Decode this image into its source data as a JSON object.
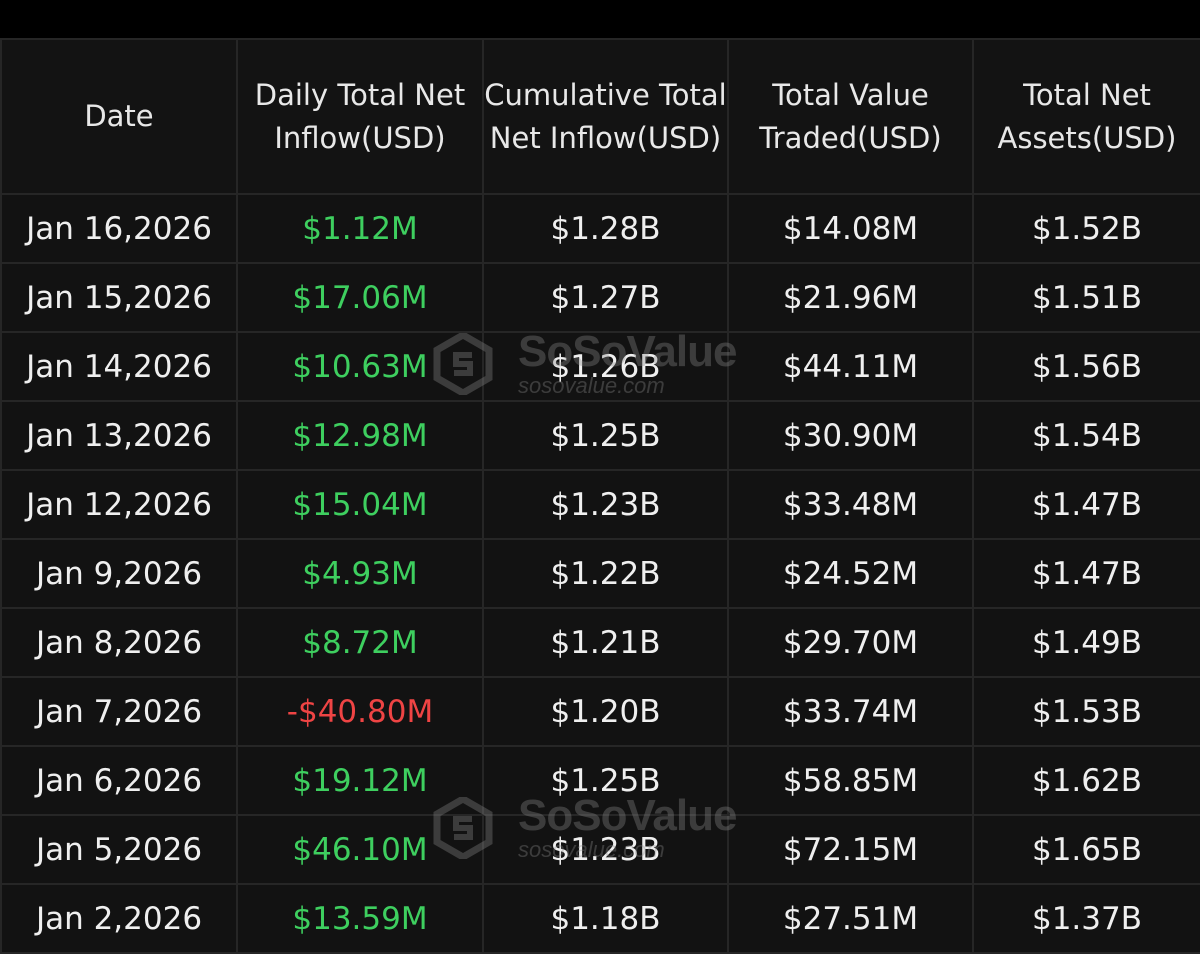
{
  "table": {
    "headers": {
      "date": "Date",
      "daily_net_inflow": "Daily Total Net Inflow(USD)",
      "cumulative_net_inflow": "Cumulative Total Net Inflow(USD)",
      "total_value_traded": "Total Value Traded(USD)",
      "total_net_assets": "Total Net Assets(USD)"
    },
    "rows": [
      {
        "date": "Jan 16,2026",
        "daily": "$1.12M",
        "daily_sign": "positive",
        "cumulative": "$1.28B",
        "traded": "$14.08M",
        "assets": "$1.52B"
      },
      {
        "date": "Jan 15,2026",
        "daily": "$17.06M",
        "daily_sign": "positive",
        "cumulative": "$1.27B",
        "traded": "$21.96M",
        "assets": "$1.51B"
      },
      {
        "date": "Jan 14,2026",
        "daily": "$10.63M",
        "daily_sign": "positive",
        "cumulative": "$1.26B",
        "traded": "$44.11M",
        "assets": "$1.56B"
      },
      {
        "date": "Jan 13,2026",
        "daily": "$12.98M",
        "daily_sign": "positive",
        "cumulative": "$1.25B",
        "traded": "$30.90M",
        "assets": "$1.54B"
      },
      {
        "date": "Jan 12,2026",
        "daily": "$15.04M",
        "daily_sign": "positive",
        "cumulative": "$1.23B",
        "traded": "$33.48M",
        "assets": "$1.47B"
      },
      {
        "date": "Jan 9,2026",
        "daily": "$4.93M",
        "daily_sign": "positive",
        "cumulative": "$1.22B",
        "traded": "$24.52M",
        "assets": "$1.47B"
      },
      {
        "date": "Jan 8,2026",
        "daily": "$8.72M",
        "daily_sign": "positive",
        "cumulative": "$1.21B",
        "traded": "$29.70M",
        "assets": "$1.49B"
      },
      {
        "date": "Jan 7,2026",
        "daily": "-$40.80M",
        "daily_sign": "negative",
        "cumulative": "$1.20B",
        "traded": "$33.74M",
        "assets": "$1.53B"
      },
      {
        "date": "Jan 6,2026",
        "daily": "$19.12M",
        "daily_sign": "positive",
        "cumulative": "$1.25B",
        "traded": "$58.85M",
        "assets": "$1.62B"
      },
      {
        "date": "Jan 5,2026",
        "daily": "$46.10M",
        "daily_sign": "positive",
        "cumulative": "$1.23B",
        "traded": "$72.15M",
        "assets": "$1.65B"
      },
      {
        "date": "Jan 2,2026",
        "daily": "$13.59M",
        "daily_sign": "positive",
        "cumulative": "$1.18B",
        "traded": "$27.51M",
        "assets": "$1.37B"
      }
    ]
  },
  "watermark": {
    "brand": "SoSoValue",
    "url": "sosovalue.com",
    "icon": "sosovalue-logo-icon"
  },
  "colors": {
    "background": "#000000",
    "cell_background": "#121212",
    "grid_line": "#262626",
    "text": "#efefef",
    "positive": "#3ecf5f",
    "negative": "#ef4444"
  }
}
